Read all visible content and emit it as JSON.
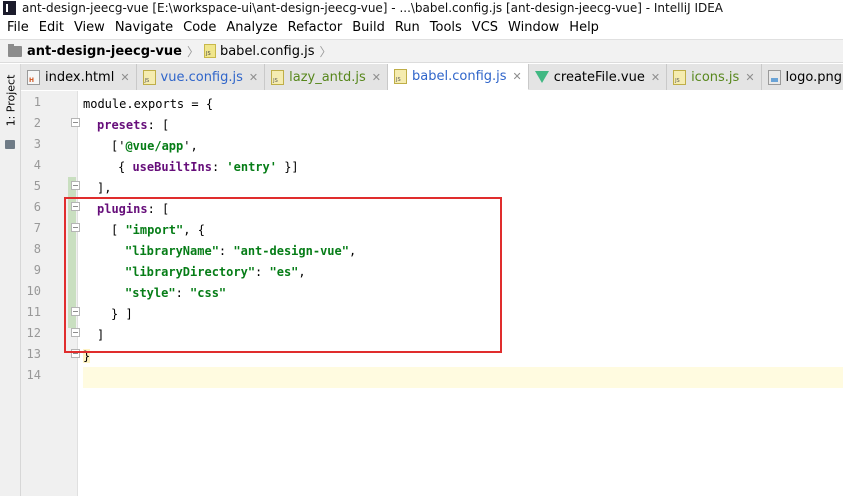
{
  "window": {
    "title": "ant-design-jeecg-vue [E:\\workspace-ui\\ant-design-jeecg-vue] - ...\\babel.config.js [ant-design-jeecg-vue] - IntelliJ IDEA"
  },
  "menu": [
    "File",
    "Edit",
    "View",
    "Navigate",
    "Code",
    "Analyze",
    "Refactor",
    "Build",
    "Run",
    "Tools",
    "VCS",
    "Window",
    "Help"
  ],
  "breadcrumb": {
    "project": "ant-design-jeecg-vue",
    "file": "babel.config.js"
  },
  "tool_window": {
    "project_label": "1: Project"
  },
  "tabs": [
    {
      "label": "index.html",
      "icon": "html-file-icon"
    },
    {
      "label": "vue.config.js",
      "icon": "js-file-icon"
    },
    {
      "label": "lazy_antd.js",
      "icon": "js-file-icon"
    },
    {
      "label": "babel.config.js",
      "icon": "js-file-icon",
      "active": true
    },
    {
      "label": "createFile.vue",
      "icon": "vue-file-icon"
    },
    {
      "label": "icons.js",
      "icon": "js-file-icon"
    },
    {
      "label": "logo.png",
      "icon": "png-file-icon"
    }
  ],
  "editor": {
    "line_numbers": [
      "1",
      "2",
      "3",
      "4",
      "5",
      "6",
      "7",
      "8",
      "9",
      "10",
      "11",
      "12",
      "13",
      "14"
    ],
    "code": {
      "l1": "module.exports = {",
      "l2_prop": "presets",
      "l2_rest": ": [",
      "l3_pre": "['",
      "l3_str": "@vue/app",
      "l3_post": "',",
      "l4_pre": "{ ",
      "l4_prop": "useBuiltIns",
      "l4_mid": ": ",
      "l4_str": "'entry'",
      "l4_post": " }]",
      "l5": "],",
      "l6_prop": "plugins",
      "l6_rest": ": [",
      "l7_pre": "[ ",
      "l7_str": "\"import\"",
      "l7_post": ", {",
      "l8_key": "\"libraryName\"",
      "l8_mid": ": ",
      "l8_val": "\"ant-design-vue\"",
      "l8_post": ",",
      "l9_key": "\"libraryDirectory\"",
      "l9_mid": ": ",
      "l9_val": "\"es\"",
      "l9_post": ",",
      "l10_key": "\"style\"",
      "l10_mid": ": ",
      "l10_val": "\"css\"",
      "l11": "} ]",
      "l12": "]",
      "l13": "}",
      "l14": ""
    }
  },
  "colors": {
    "highlight_box": "#e02d2d",
    "property": "#660e7a",
    "string": "#067d17"
  }
}
